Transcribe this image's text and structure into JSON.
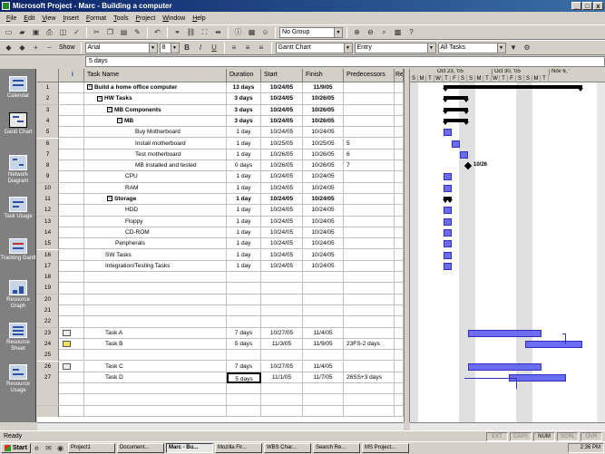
{
  "window": {
    "title": "Microsoft Project - Marc - Building a computer",
    "controls": [
      "_",
      "□",
      "x"
    ]
  },
  "menu": [
    "File",
    "Edit",
    "View",
    "Insert",
    "Format",
    "Tools",
    "Project",
    "Window",
    "Help"
  ],
  "toolbar": {
    "group": "No Group",
    "zoom_unknown": "?"
  },
  "formatting": {
    "font": "Arial",
    "size": "8",
    "bold": "B",
    "italic": "I",
    "underline": "U",
    "view": "Gantt Chart",
    "table": "Entry",
    "filter": "All Tasks",
    "show_label": "Show"
  },
  "entry_bar": {
    "value": "5 days"
  },
  "view_bar": [
    {
      "label": "Calendar",
      "active": false
    },
    {
      "label": "Gantt Chart",
      "active": true
    },
    {
      "label": "Network Diagram",
      "active": false
    },
    {
      "label": "Task Usage",
      "active": false
    },
    {
      "label": "Tracking Gantt",
      "active": false
    },
    {
      "label": "Resource Graph",
      "active": false
    },
    {
      "label": "Resource Sheet",
      "active": false
    },
    {
      "label": "Resource Usage",
      "active": false
    }
  ],
  "columns": {
    "info": "i",
    "name": "Task Name",
    "duration": "Duration",
    "start": "Start",
    "finish": "Finish",
    "predecessors": "Predecessors",
    "resources": "Re"
  },
  "tasks": [
    {
      "id": "1",
      "name": "Build a home office computer",
      "level": 0,
      "summary": true,
      "duration": "13 days",
      "start": "10/24/05",
      "finish": "11/9/05",
      "pred": "",
      "indicator": ""
    },
    {
      "id": "2",
      "name": "HW Tasks",
      "level": 1,
      "summary": true,
      "duration": "3 days",
      "start": "10/24/05",
      "finish": "10/26/05",
      "pred": "",
      "indicator": ""
    },
    {
      "id": "3",
      "name": "MB Components",
      "level": 2,
      "summary": true,
      "duration": "3 days",
      "start": "10/24/05",
      "finish": "10/26/05",
      "pred": "",
      "indicator": ""
    },
    {
      "id": "4",
      "name": "MB",
      "level": 3,
      "summary": true,
      "duration": "3 days",
      "start": "10/24/05",
      "finish": "10/26/05",
      "pred": "",
      "indicator": ""
    },
    {
      "id": "5",
      "name": "Buy Motherboard",
      "level": 4,
      "summary": false,
      "duration": "1 day",
      "start": "10/24/05",
      "finish": "10/24/05",
      "pred": "",
      "indicator": ""
    },
    {
      "id": "6",
      "name": "Install motherboard",
      "level": 4,
      "summary": false,
      "duration": "1 day",
      "start": "10/25/05",
      "finish": "10/25/05",
      "pred": "5",
      "indicator": ""
    },
    {
      "id": "7",
      "name": "Test motherboard",
      "level": 4,
      "summary": false,
      "duration": "1 day",
      "start": "10/26/05",
      "finish": "10/26/05",
      "pred": "6",
      "indicator": ""
    },
    {
      "id": "8",
      "name": "MB installed and tested",
      "level": 4,
      "summary": false,
      "duration": "0 days",
      "start": "10/26/05",
      "finish": "10/26/05",
      "pred": "7",
      "indicator": ""
    },
    {
      "id": "9",
      "name": "CPU",
      "level": 3,
      "summary": false,
      "duration": "1 day",
      "start": "10/24/05",
      "finish": "10/24/05",
      "pred": "",
      "indicator": ""
    },
    {
      "id": "10",
      "name": "RAM",
      "level": 3,
      "summary": false,
      "duration": "1 day",
      "start": "10/24/05",
      "finish": "10/24/05",
      "pred": "",
      "indicator": ""
    },
    {
      "id": "11",
      "name": "Storage",
      "level": 2,
      "summary": true,
      "duration": "1 day",
      "start": "10/24/05",
      "finish": "10/24/05",
      "pred": "",
      "indicator": ""
    },
    {
      "id": "12",
      "name": "HDD",
      "level": 3,
      "summary": false,
      "duration": "1 day",
      "start": "10/24/05",
      "finish": "10/24/05",
      "pred": "",
      "indicator": ""
    },
    {
      "id": "13",
      "name": "Floppy",
      "level": 3,
      "summary": false,
      "duration": "1 day",
      "start": "10/24/05",
      "finish": "10/24/05",
      "pred": "",
      "indicator": ""
    },
    {
      "id": "14",
      "name": "CD-ROM",
      "level": 3,
      "summary": false,
      "duration": "1 day",
      "start": "10/24/05",
      "finish": "10/24/05",
      "pred": "",
      "indicator": ""
    },
    {
      "id": "15",
      "name": "Peripherals",
      "level": 2,
      "summary": false,
      "duration": "1 day",
      "start": "10/24/05",
      "finish": "10/24/05",
      "pred": "",
      "indicator": ""
    },
    {
      "id": "16",
      "name": "SW Tasks",
      "level": 1,
      "summary": false,
      "duration": "1 day",
      "start": "10/24/05",
      "finish": "10/24/05",
      "pred": "",
      "indicator": ""
    },
    {
      "id": "17",
      "name": "Integration/Testing Tasks",
      "level": 1,
      "summary": false,
      "duration": "1 day",
      "start": "10/24/05",
      "finish": "10/24/05",
      "pred": "",
      "indicator": ""
    },
    {
      "id": "18",
      "name": "",
      "level": 0,
      "summary": false,
      "duration": "",
      "start": "",
      "finish": "",
      "pred": "",
      "indicator": ""
    },
    {
      "id": "19",
      "name": "",
      "level": 0,
      "summary": false,
      "duration": "",
      "start": "",
      "finish": "",
      "pred": "",
      "indicator": ""
    },
    {
      "id": "20",
      "name": "",
      "level": 0,
      "summary": false,
      "duration": "",
      "start": "",
      "finish": "",
      "pred": "",
      "indicator": ""
    },
    {
      "id": "21",
      "name": "",
      "level": 0,
      "summary": false,
      "duration": "",
      "start": "",
      "finish": "",
      "pred": "",
      "indicator": ""
    },
    {
      "id": "22",
      "name": "",
      "level": 0,
      "summary": false,
      "duration": "",
      "start": "",
      "finish": "",
      "pred": "",
      "indicator": ""
    },
    {
      "id": "23",
      "name": "Task A",
      "level": 1,
      "summary": false,
      "duration": "7 days",
      "start": "10/27/05",
      "finish": "11/4/05",
      "pred": "",
      "indicator": "calendar"
    },
    {
      "id": "24",
      "name": "Task B",
      "level": 1,
      "summary": false,
      "duration": "5 days",
      "start": "11/3/05",
      "finish": "11/9/05",
      "pred": "23FS-2 days",
      "indicator": "note"
    },
    {
      "id": "25",
      "name": "",
      "level": 0,
      "summary": false,
      "duration": "",
      "start": "",
      "finish": "",
      "pred": "",
      "indicator": ""
    },
    {
      "id": "26",
      "name": "Task C",
      "level": 1,
      "summary": false,
      "duration": "7 days",
      "start": "10/27/05",
      "finish": "11/4/05",
      "pred": "",
      "indicator": "calendar"
    },
    {
      "id": "27",
      "name": "Task D",
      "level": 1,
      "summary": false,
      "duration": "5 days",
      "start": "11/1/05",
      "finish": "11/7/05",
      "pred": "26SS+3 days",
      "indicator": "",
      "selected_duration": true
    },
    {
      "id": "",
      "name": "",
      "level": 0,
      "summary": false,
      "duration": "",
      "start": "",
      "finish": "",
      "pred": "",
      "indicator": ""
    },
    {
      "id": "",
      "name": "",
      "level": 0,
      "summary": false,
      "duration": "",
      "start": "",
      "finish": "",
      "pred": "",
      "indicator": ""
    },
    {
      "id": "",
      "name": "",
      "level": 0,
      "summary": false,
      "duration": "",
      "start": "",
      "finish": "",
      "pred": "",
      "indicator": ""
    }
  ],
  "gantt": {
    "weeks": [
      "Oct 23, '05",
      "Oct 30, '05",
      "Nov 6, '"
    ],
    "days": [
      "S",
      "M",
      "T",
      "W",
      "T",
      "F",
      "S",
      "S",
      "M",
      "T",
      "W",
      "T",
      "F",
      "S",
      "S",
      "M",
      "T"
    ],
    "milestone_label": "10/26",
    "colors": {
      "bar": "#6c6cf0",
      "bar_border": "#3030c0",
      "summary": "#000000"
    }
  },
  "status": {
    "text": "Ready",
    "indicators": [
      "EXT",
      "CAPS",
      "NUM",
      "SCRL",
      "OVR"
    ],
    "active": [
      "NUM"
    ]
  },
  "taskbar": {
    "start": "Start",
    "tasks": [
      "Project1",
      "Document...",
      "Marc - Bu...",
      "Mozilla Fir...",
      "WBS Char...",
      "Search Re...",
      "MS Project..."
    ],
    "active_index": 2,
    "clock": "2:36 PM"
  }
}
